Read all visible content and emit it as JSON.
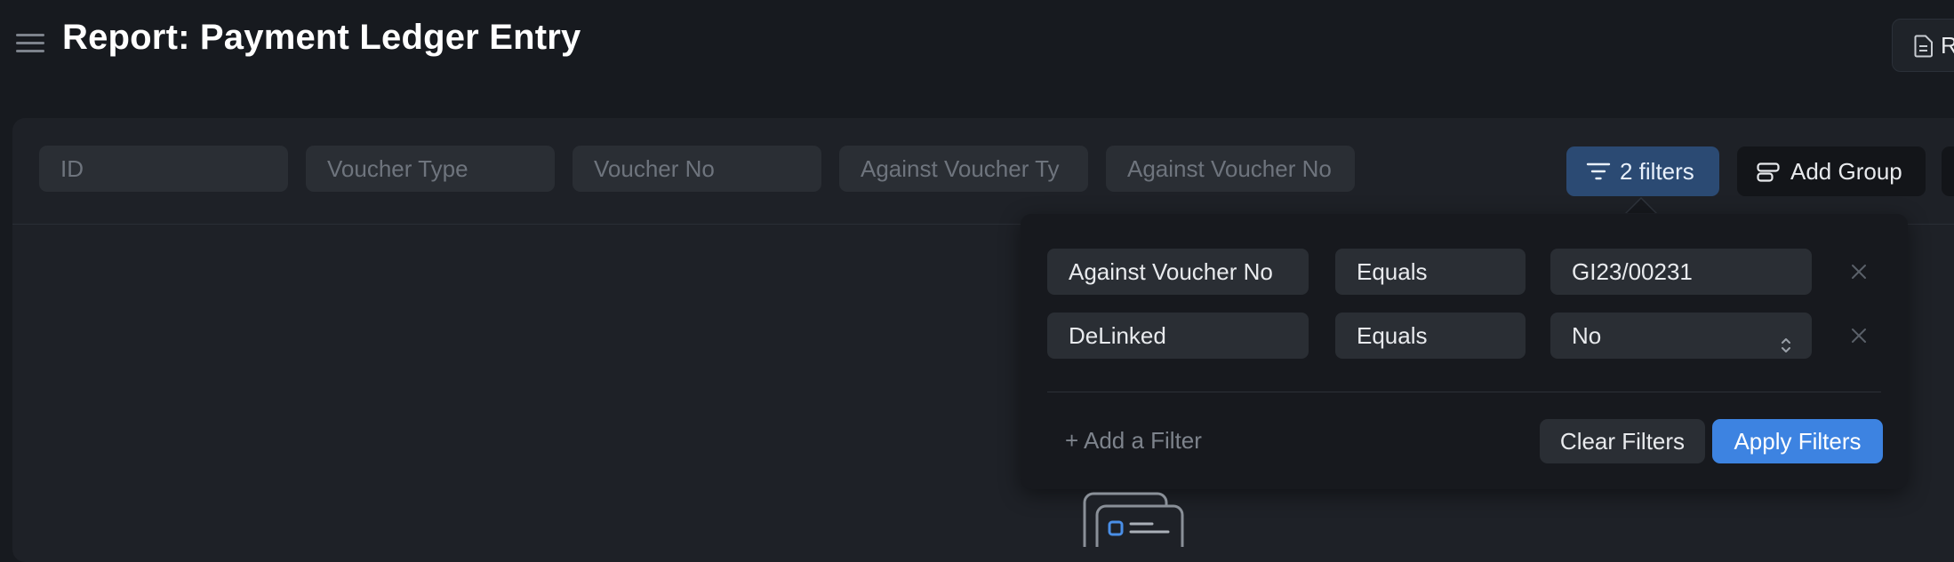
{
  "header": {
    "title": "Report: Payment Ledger Entry",
    "action_button_label": "R"
  },
  "filter_bar": {
    "fields": [
      {
        "placeholder": "ID"
      },
      {
        "placeholder": "Voucher Type"
      },
      {
        "placeholder": "Voucher No"
      },
      {
        "placeholder": "Against Voucher Ty"
      },
      {
        "placeholder": "Against Voucher No"
      }
    ],
    "filters_button_label": "2 filters",
    "add_group_label": "Add Group"
  },
  "filter_popover": {
    "rows": [
      {
        "field": "Against Voucher No",
        "operator": "Equals",
        "value": "GI23/00231",
        "value_is_select": false
      },
      {
        "field": "DeLinked",
        "operator": "Equals",
        "value": "No",
        "value_is_select": true
      }
    ],
    "add_filter_label": "+ Add a Filter",
    "clear_label": "Clear Filters",
    "apply_label": "Apply Filters"
  },
  "colors": {
    "background": "#171a1f",
    "panel": "#1e2127",
    "accent_blue": "#3d83e1",
    "filters_button": "#2b4a73"
  },
  "icons": {
    "menu": "hamburger-icon",
    "report_button": "document-icon",
    "filters": "filter-icon",
    "group": "group-icon",
    "remove": "close-icon",
    "select": "chevron-updown-icon",
    "empty_state": "empty-list-icon"
  }
}
